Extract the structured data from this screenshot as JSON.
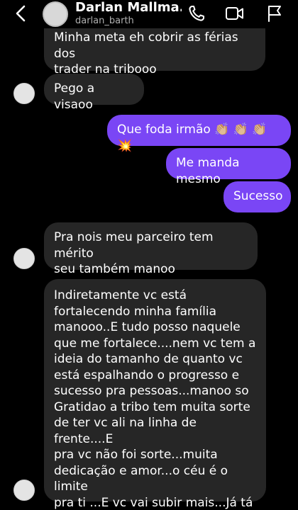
{
  "header": {
    "name": "Darlan Mallma...",
    "username": "darlan_barth"
  },
  "messages": [
    {
      "dir": "in",
      "text": "Minha meta eh cobrir as férias dos\ntrader na tribooo"
    },
    {
      "dir": "in",
      "text": "Pego a visaoo"
    },
    {
      "dir": "out",
      "text": "Que foda irmão 👏🏼 👏🏼 👏🏼 💥"
    },
    {
      "dir": "out",
      "text": "Me manda mesmo"
    },
    {
      "dir": "out",
      "text": "Sucesso"
    },
    {
      "dir": "in",
      "text": "Pra nois meu parceiro tem mérito\nseu também manoo"
    },
    {
      "dir": "in",
      "text": "Indiretamente vc está\nfortalecendo minha família\nmanooo..E tudo posso naquele\nque me fortalece....nem vc tem a\nideia do tamanho de quanto vc\nestá espalhando o progresso e\nsucesso pra pessoas...manoo so\nGratidao a tribo tem muita sorte\nde ter vc ali na linha de frente....E\npra vc não foi sorte...muita\ndedicação e amor...o céu é o limite\npra ti ...E vc vai subir mais...Já tá\ndecidido"
    }
  ],
  "colors": {
    "incoming_bubble": "#262626",
    "outgoing_bubble": "#7a46f5",
    "background": "#000000"
  },
  "icons": [
    "back-arrow-icon",
    "phone-icon",
    "video-camera-icon",
    "flag-icon"
  ]
}
